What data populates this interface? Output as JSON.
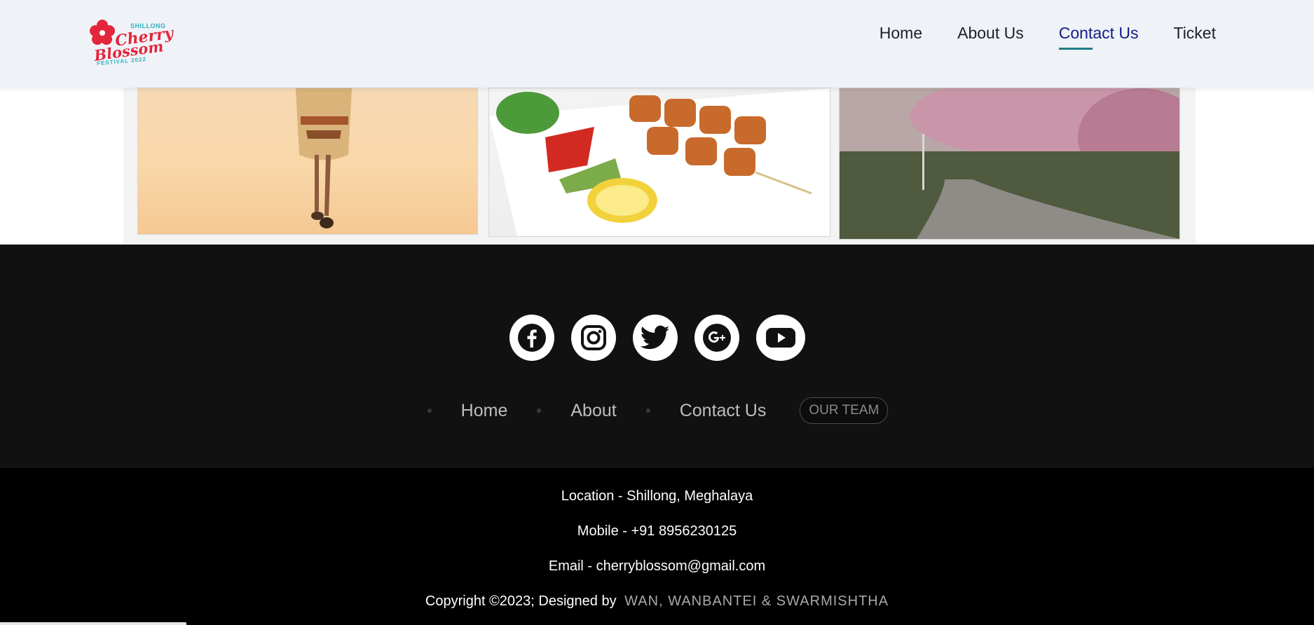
{
  "header": {
    "logo": {
      "top": "SHILLONG",
      "line1": "Cherry",
      "line2": "Blossom",
      "bottom": "FESTIVAL 2022"
    },
    "nav": [
      {
        "label": "Home",
        "active": false
      },
      {
        "label": "About Us",
        "active": false
      },
      {
        "label": "Contact Us",
        "active": true
      },
      {
        "label": "Ticket",
        "active": false
      }
    ]
  },
  "footer": {
    "socials": [
      "facebook-icon",
      "instagram-icon",
      "twitter-icon",
      "google-plus-icon",
      "youtube-icon"
    ],
    "links": {
      "home": "Home",
      "about": "About",
      "contact": "Contact Us",
      "team": "OUR TEAM"
    },
    "location": "Location - Shillong, Meghalaya",
    "mobile": "Mobile - +91 8956230125",
    "email": "Email - cherryblossom@gmail.com",
    "copyright": "Copyright ©2023; Designed by",
    "designers": "WAN, WANBANTEI & SWARMISHTHA"
  },
  "colors": {
    "accent": "#151c86",
    "underline": "#1c7f86",
    "logo_red": "#e2263c",
    "logo_teal": "#2bb3c0"
  }
}
